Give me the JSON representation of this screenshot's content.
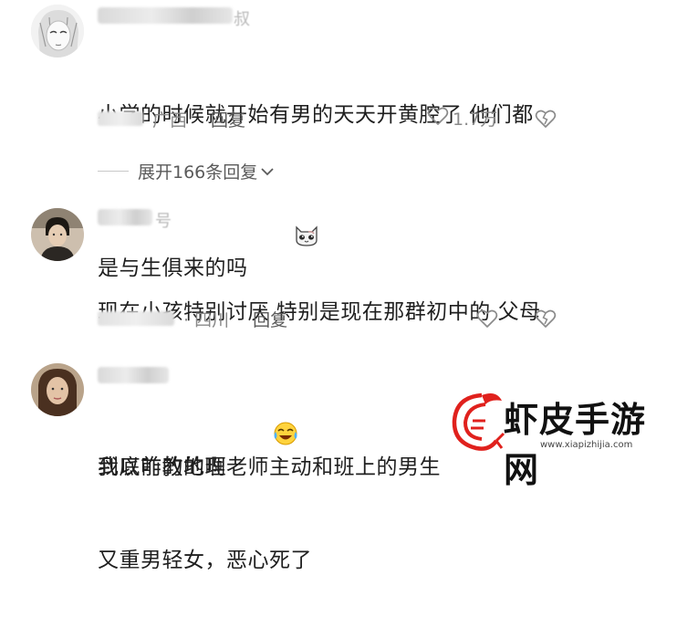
{
  "comments": [
    {
      "username_suffix": "叔",
      "text_line1": "小学的时候就开始有男的天天开黄腔了 他们都",
      "text_line2": "是与生俱来的吗",
      "emoji_icon": "cat-face-icon",
      "location": "广西",
      "reply_label": "回复",
      "likes": "1.7万"
    },
    {
      "username_suffix": "号",
      "text_line1": "现在小孩特别讨厌 特别是现在那群初中的 父母",
      "text_line2": "到底咋教的啊",
      "emoji_icon": "crying-laughing-face-icon",
      "location": "· 四川",
      "reply_label": "回复",
      "likes": ""
    },
    {
      "username_suffix": "",
      "text_line1": "我以前的地理老师主动和班上的男生",
      "text_line2": "又重男轻女，恶心死了"
    }
  ],
  "expand_replies_label": "展开166条回复",
  "watermark": {
    "name": "虾皮手游网",
    "url": "www.xiapizhijia.com",
    "logo_color": "#e0211d"
  }
}
